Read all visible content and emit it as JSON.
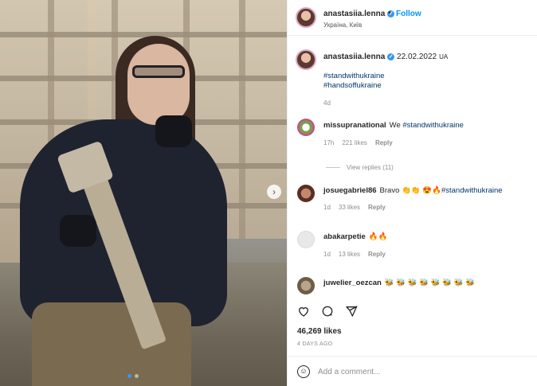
{
  "colors": {
    "accent": "#0095f6",
    "verified": "#3897f0",
    "hashtag": "#00376b",
    "muted": "#8e8e8e"
  },
  "post": {
    "author": "anastasiia.lenna",
    "follow_label": "Follow",
    "location": "Україна, Київ",
    "caption": {
      "username": "anastasiia.lenna",
      "date": "22.02.2022",
      "flag": "UA",
      "hashtags": [
        "#standwithukraine",
        "#handsoffukraine"
      ],
      "time": "4d"
    }
  },
  "comments": [
    {
      "user": "missupranational",
      "text_pre": "We ",
      "hashtag": "#standwithukraine",
      "time": "17h",
      "likes": "221 likes",
      "reply": "Reply"
    },
    {
      "user": "josuegabriel86",
      "text_pre": "Bravo 👏👏 😍🔥",
      "hashtag": "#standwithukraine",
      "time": "1d",
      "likes": "33 likes",
      "reply": "Reply"
    },
    {
      "user": "abakarpetie",
      "text_pre": "🔥🔥",
      "hashtag": "",
      "time": "1d",
      "likes": "13 likes",
      "reply": "Reply"
    },
    {
      "user": "juwelier_oezcan",
      "text_pre": "🐝 🐝 🐝 🐝 🐝 🐝 🐝 🐝",
      "hashtag": "",
      "time": "",
      "likes": "",
      "reply": ""
    }
  ],
  "view_replies": "View replies (11)",
  "likes_count": "46,269 likes",
  "posted_ago": "4 DAYS AGO",
  "comment_box": {
    "placeholder": "Add a comment..."
  },
  "icons": {
    "like": "heart-icon",
    "comment": "comment-icon",
    "share": "share-icon",
    "emoji": "emoji-icon",
    "next": "chevron-right-icon"
  }
}
